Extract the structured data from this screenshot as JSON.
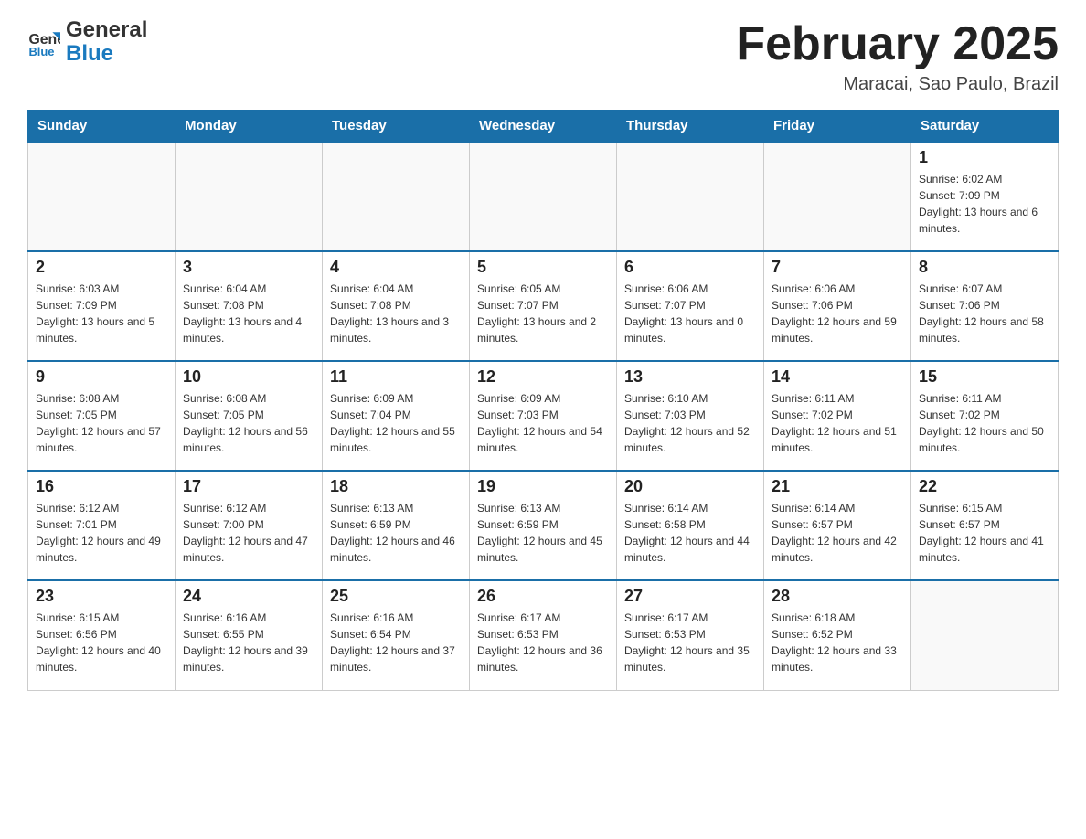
{
  "header": {
    "title": "February 2025",
    "location": "Maracai, Sao Paulo, Brazil",
    "logo_general": "General",
    "logo_blue": "Blue"
  },
  "days_of_week": [
    "Sunday",
    "Monday",
    "Tuesday",
    "Wednesday",
    "Thursday",
    "Friday",
    "Saturday"
  ],
  "weeks": [
    [
      {
        "day": "",
        "info": ""
      },
      {
        "day": "",
        "info": ""
      },
      {
        "day": "",
        "info": ""
      },
      {
        "day": "",
        "info": ""
      },
      {
        "day": "",
        "info": ""
      },
      {
        "day": "",
        "info": ""
      },
      {
        "day": "1",
        "info": "Sunrise: 6:02 AM\nSunset: 7:09 PM\nDaylight: 13 hours and 6 minutes."
      }
    ],
    [
      {
        "day": "2",
        "info": "Sunrise: 6:03 AM\nSunset: 7:09 PM\nDaylight: 13 hours and 5 minutes."
      },
      {
        "day": "3",
        "info": "Sunrise: 6:04 AM\nSunset: 7:08 PM\nDaylight: 13 hours and 4 minutes."
      },
      {
        "day": "4",
        "info": "Sunrise: 6:04 AM\nSunset: 7:08 PM\nDaylight: 13 hours and 3 minutes."
      },
      {
        "day": "5",
        "info": "Sunrise: 6:05 AM\nSunset: 7:07 PM\nDaylight: 13 hours and 2 minutes."
      },
      {
        "day": "6",
        "info": "Sunrise: 6:06 AM\nSunset: 7:07 PM\nDaylight: 13 hours and 0 minutes."
      },
      {
        "day": "7",
        "info": "Sunrise: 6:06 AM\nSunset: 7:06 PM\nDaylight: 12 hours and 59 minutes."
      },
      {
        "day": "8",
        "info": "Sunrise: 6:07 AM\nSunset: 7:06 PM\nDaylight: 12 hours and 58 minutes."
      }
    ],
    [
      {
        "day": "9",
        "info": "Sunrise: 6:08 AM\nSunset: 7:05 PM\nDaylight: 12 hours and 57 minutes."
      },
      {
        "day": "10",
        "info": "Sunrise: 6:08 AM\nSunset: 7:05 PM\nDaylight: 12 hours and 56 minutes."
      },
      {
        "day": "11",
        "info": "Sunrise: 6:09 AM\nSunset: 7:04 PM\nDaylight: 12 hours and 55 minutes."
      },
      {
        "day": "12",
        "info": "Sunrise: 6:09 AM\nSunset: 7:03 PM\nDaylight: 12 hours and 54 minutes."
      },
      {
        "day": "13",
        "info": "Sunrise: 6:10 AM\nSunset: 7:03 PM\nDaylight: 12 hours and 52 minutes."
      },
      {
        "day": "14",
        "info": "Sunrise: 6:11 AM\nSunset: 7:02 PM\nDaylight: 12 hours and 51 minutes."
      },
      {
        "day": "15",
        "info": "Sunrise: 6:11 AM\nSunset: 7:02 PM\nDaylight: 12 hours and 50 minutes."
      }
    ],
    [
      {
        "day": "16",
        "info": "Sunrise: 6:12 AM\nSunset: 7:01 PM\nDaylight: 12 hours and 49 minutes."
      },
      {
        "day": "17",
        "info": "Sunrise: 6:12 AM\nSunset: 7:00 PM\nDaylight: 12 hours and 47 minutes."
      },
      {
        "day": "18",
        "info": "Sunrise: 6:13 AM\nSunset: 6:59 PM\nDaylight: 12 hours and 46 minutes."
      },
      {
        "day": "19",
        "info": "Sunrise: 6:13 AM\nSunset: 6:59 PM\nDaylight: 12 hours and 45 minutes."
      },
      {
        "day": "20",
        "info": "Sunrise: 6:14 AM\nSunset: 6:58 PM\nDaylight: 12 hours and 44 minutes."
      },
      {
        "day": "21",
        "info": "Sunrise: 6:14 AM\nSunset: 6:57 PM\nDaylight: 12 hours and 42 minutes."
      },
      {
        "day": "22",
        "info": "Sunrise: 6:15 AM\nSunset: 6:57 PM\nDaylight: 12 hours and 41 minutes."
      }
    ],
    [
      {
        "day": "23",
        "info": "Sunrise: 6:15 AM\nSunset: 6:56 PM\nDaylight: 12 hours and 40 minutes."
      },
      {
        "day": "24",
        "info": "Sunrise: 6:16 AM\nSunset: 6:55 PM\nDaylight: 12 hours and 39 minutes."
      },
      {
        "day": "25",
        "info": "Sunrise: 6:16 AM\nSunset: 6:54 PM\nDaylight: 12 hours and 37 minutes."
      },
      {
        "day": "26",
        "info": "Sunrise: 6:17 AM\nSunset: 6:53 PM\nDaylight: 12 hours and 36 minutes."
      },
      {
        "day": "27",
        "info": "Sunrise: 6:17 AM\nSunset: 6:53 PM\nDaylight: 12 hours and 35 minutes."
      },
      {
        "day": "28",
        "info": "Sunrise: 6:18 AM\nSunset: 6:52 PM\nDaylight: 12 hours and 33 minutes."
      },
      {
        "day": "",
        "info": ""
      }
    ]
  ]
}
